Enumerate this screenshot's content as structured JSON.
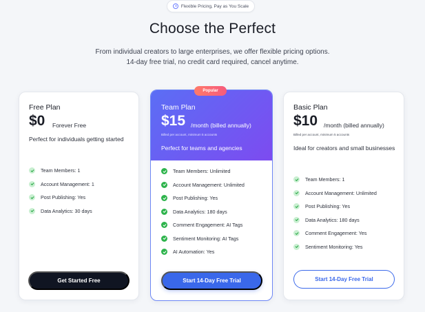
{
  "badge": {
    "icon": "clock-icon",
    "text": "Flexible Pricing, Pay as You Scale"
  },
  "header": {
    "title": "Choose the Perfect",
    "subtitle_line1": "From individual creators to large enterprises, we offer flexible pricing options.",
    "subtitle_line2": "14-day free trial, no credit card required, cancel anytime."
  },
  "plans": {
    "free": {
      "name": "Free Plan",
      "price": "$0",
      "period": "Forever Free",
      "description": "Perfect for individuals getting started",
      "features": [
        "Team Members: 1",
        "Account Management: 1",
        "Post Publishing: Yes",
        "Data Analytics: 30 days"
      ],
      "button": "Get Started Free"
    },
    "team": {
      "badge": "Popular",
      "name": "Team Plan",
      "price": "$15",
      "period": "/month (billed annually)",
      "billed_note": "Billed per account, minimum 5 accounts",
      "description": "Perfect for teams and agencies",
      "features": [
        "Team Members: Unlimited",
        "Account Management: Unlimited",
        "Post Publishing: Yes",
        "Data Analytics: 180 days",
        "Comment Engagement: AI Tags",
        "Sentiment Monitoring: AI Tags",
        "AI Automation: Yes"
      ],
      "button": "Start 14-Day Free Trial"
    },
    "basic": {
      "name": "Basic Plan",
      "price": "$10",
      "period": "/month (billed annually)",
      "billed_note": "Billed per account, minimum 5 accounts",
      "description": "Ideal for creators and small businesses",
      "features": [
        "Team Members: 1",
        "Account Management: Unlimited",
        "Post Publishing: Yes",
        "Data Analytics: 180 days",
        "Comment Engagement: Yes",
        "Sentiment Monitoring: Yes"
      ],
      "button": "Start 14-Day Free Trial"
    }
  },
  "colors": {
    "accent": "#3a68ea",
    "dark_button": "#101522",
    "check": "#2eb44c",
    "team_gradient_start": "#5b6ef5",
    "team_gradient_end": "#7d4bf0",
    "popular": "#f65b7d"
  }
}
